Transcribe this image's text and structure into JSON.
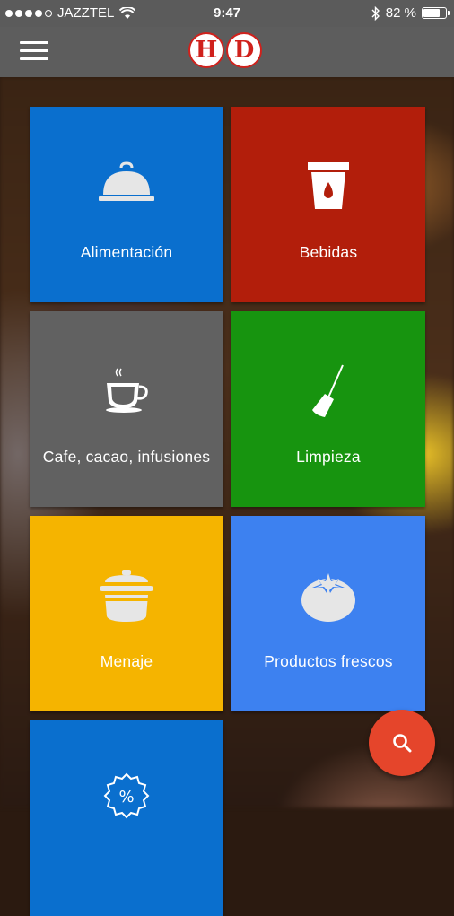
{
  "status_bar": {
    "carrier": "JAZZTEL",
    "time": "9:47",
    "battery_text": "82 %",
    "battery_level": 0.82,
    "signal_bars_filled": 4,
    "signal_bars_total": 5
  },
  "app_bar": {
    "logo_letters": [
      "H",
      "D"
    ],
    "logo_color": "#d0211c"
  },
  "categories": [
    {
      "label": "Alimentación",
      "color": "#0a6fce",
      "icon": "cloche-icon"
    },
    {
      "label": "Bebidas",
      "color": "#b21e0b",
      "icon": "drink-cup-icon"
    },
    {
      "label": "Cafe, cacao, infusiones",
      "color": "#616161",
      "icon": "coffee-cup-icon"
    },
    {
      "label": "Limpieza",
      "color": "#17940f",
      "icon": "broom-icon"
    },
    {
      "label": "Menaje",
      "color": "#f5b400",
      "icon": "cooking-pot-icon"
    },
    {
      "label": "Productos frescos",
      "color": "#3d81f0",
      "icon": "tomato-icon"
    },
    {
      "label": "",
      "color": "#0a6fce",
      "icon": "discount-badge-icon"
    }
  ],
  "fab": {
    "icon": "search-icon",
    "color": "#e5452b"
  }
}
